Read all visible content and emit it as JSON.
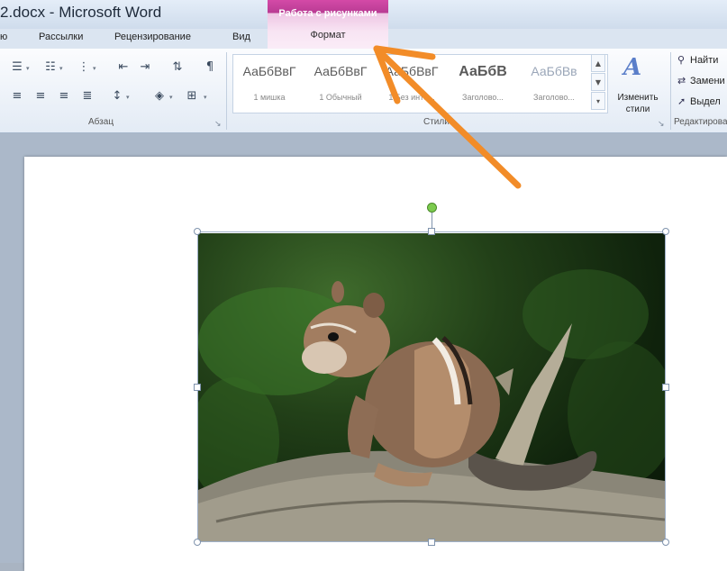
{
  "window": {
    "title": "2.docx - Microsoft Word"
  },
  "context_tab": {
    "group_title": "Работа с рисунками",
    "tab_label": "Формат",
    "color": "#c2449c"
  },
  "tabs": [
    {
      "label": "ю"
    },
    {
      "label": "Рассылки"
    },
    {
      "label": "Рецензирование"
    },
    {
      "label": "Вид"
    }
  ],
  "ribbon": {
    "paragraph_group_label": "Абзац",
    "styles_group_label": "Стили",
    "editing_group_label": "Редактирова",
    "styles_gallery": [
      {
        "sample": "АаБбВвГ",
        "name": "1 мишка"
      },
      {
        "sample": "АаБбВвГ",
        "name": "1 Обычный"
      },
      {
        "sample": "АаБбВвГ",
        "name": "1 Без инте..."
      },
      {
        "sample": "АаБбВ",
        "name": "Заголово..."
      },
      {
        "sample": "АаБбВв",
        "name": "Заголово..."
      }
    ],
    "change_styles_label": "Изменить стили",
    "editing_items": [
      {
        "icon": "binoculars-icon",
        "label": "Найти"
      },
      {
        "icon": "replace-icon",
        "label": "Замени"
      },
      {
        "icon": "cursor-icon",
        "label": "Выдел"
      }
    ]
  },
  "document": {
    "picture_subject": "chipmunk on a log"
  },
  "annotation": {
    "arrow_color": "#f28c28"
  }
}
